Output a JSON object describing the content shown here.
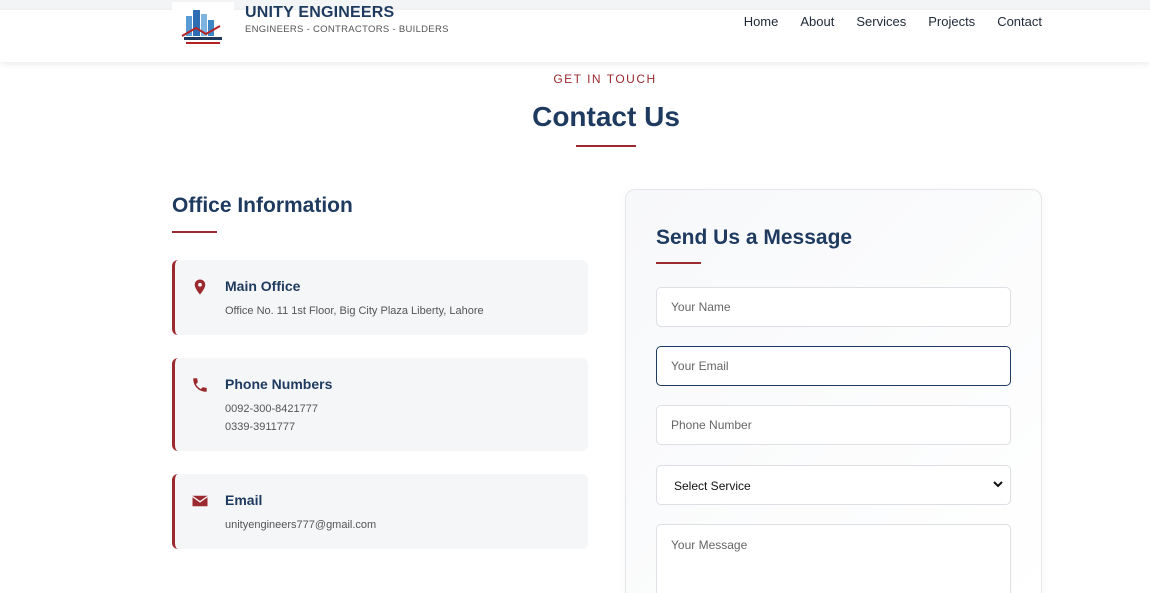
{
  "header": {
    "brand_name": "UNITY ENGINEERS",
    "brand_tagline": "ENGINEERS - CONTRACTORS - BUILDERS",
    "nav": [
      "Home",
      "About",
      "Services",
      "Projects",
      "Contact"
    ]
  },
  "hero": {
    "eyebrow": "GET IN TOUCH",
    "title": "Contact Us"
  },
  "office": {
    "heading": "Office Information",
    "cards": [
      {
        "icon": "map-pin-icon",
        "title": "Main Office",
        "lines": [
          "Office No. 11 1st Floor, Big City Plaza Liberty, Lahore"
        ]
      },
      {
        "icon": "phone-icon",
        "title": "Phone Numbers",
        "lines": [
          "0092-300-8421777",
          "0339-3911777"
        ]
      },
      {
        "icon": "envelope-icon",
        "title": "Email",
        "lines": [
          "unityengineers777@gmail.com"
        ]
      }
    ]
  },
  "form": {
    "heading": "Send Us a Message",
    "name_placeholder": "Your Name",
    "email_placeholder": "Your Email",
    "phone_placeholder": "Phone Number",
    "service_selected": "Select Service",
    "message_placeholder": "Your Message"
  },
  "colors": {
    "primary": "#1e3a5f",
    "accent": "#9b2a2f",
    "card_bg": "#f5f6f8"
  }
}
